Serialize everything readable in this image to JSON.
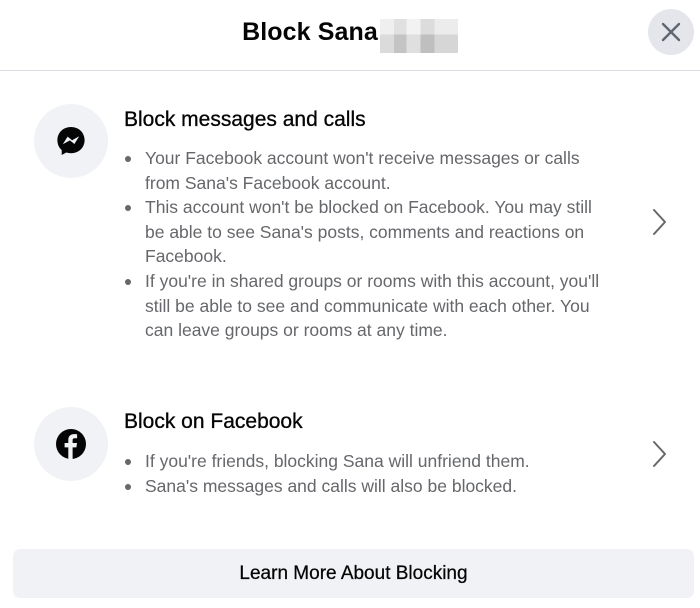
{
  "header": {
    "title": "Block Sana"
  },
  "icons": {
    "close": "close-icon",
    "messenger": "messenger-icon",
    "facebook": "facebook-icon",
    "chevron": "chevron-right-icon"
  },
  "sections": [
    {
      "heading": "Block messages and calls",
      "bullets": [
        "Your Facebook account won't receive messages or calls from Sana's Facebook account.",
        "This account won't be blocked on Facebook. You may still be able to see Sana's posts, comments and reactions on Facebook.",
        "If you're in shared groups or rooms with this account, you'll still be able to see and communicate with each other. You can leave groups or rooms at any time."
      ]
    },
    {
      "heading": "Block on Facebook",
      "bullets": [
        "If you're friends, blocking Sana will unfriend them.",
        "Sana's messages and calls will also be blocked."
      ]
    }
  ],
  "footer": {
    "learn_more_label": "Learn More About Blocking"
  },
  "colors": {
    "primary_text": "#050505",
    "secondary_text": "#65676b",
    "button_bg": "#f0f2f5",
    "close_bg": "#e4e6eb"
  }
}
